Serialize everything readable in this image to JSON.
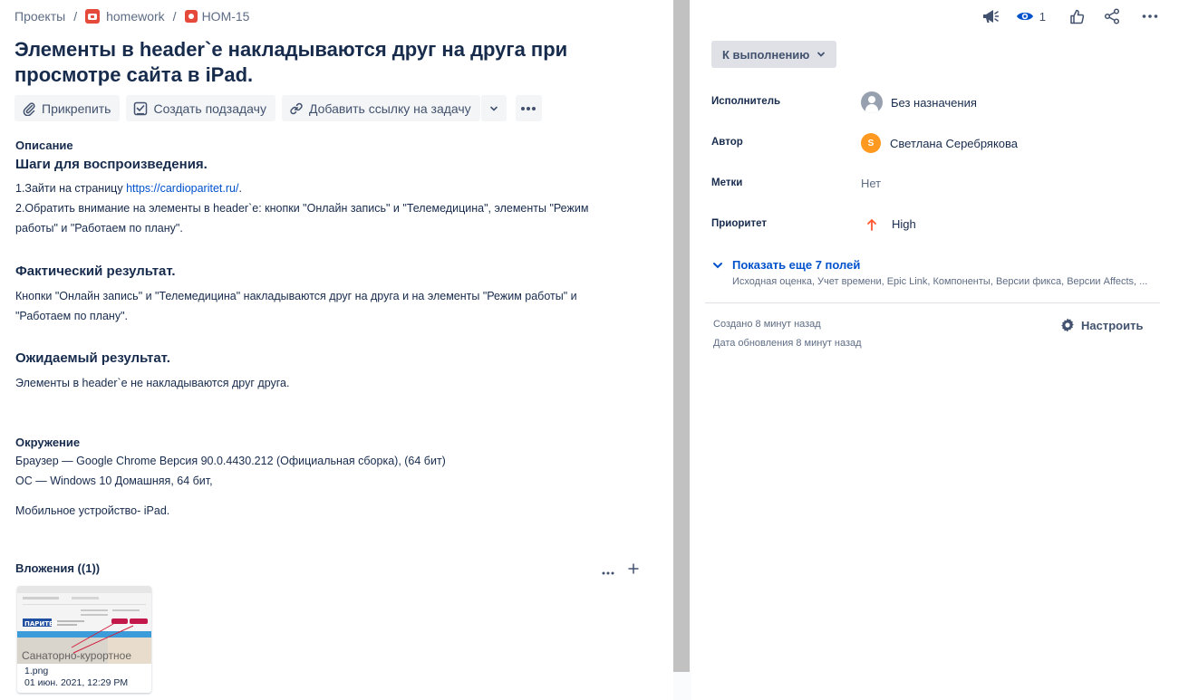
{
  "breadcrumb": {
    "projects": "Проекты",
    "project": "homework",
    "issue_key": "HOM-15"
  },
  "issue": {
    "title": "Элементы в header`е накладываются друг на друга при просмотре сайта в iPad."
  },
  "toolbar": {
    "attach": "Прикрепить",
    "subtask": "Создать подзадачу",
    "link": "Добавить ссылку на задачу"
  },
  "description": {
    "label": "Описание",
    "steps_heading": "Шаги для воспроизведения.",
    "step1_prefix": "1.Зайти на страницу ",
    "step1_link": "https://cardioparitet.ru/",
    "step1_suffix": ".",
    "step2": "2.Обратить внимание на элементы в header`е: кнопки \"Онлайн запись\" и \"Телемедицина\", элементы \"Режим работы\" и \"Работаем по плану\".",
    "actual_heading": "Фактический результат.",
    "actual_text": "Кнопки \"Онлайн запись\" и \"Телемедицина\" накладываются друг на друга и на  элементы \"Режим работы\" и \"Работаем по плану\".",
    "expected_heading": "Ожидаемый результат.",
    "expected_text": "Элементы в header`е не накладываются друг друга."
  },
  "environment": {
    "label": "Окружение",
    "browser": "Браузер —  Google Chrome Версия 90.0.4430.212 (Официальная сборка), (64 бит)",
    "os": "ОС — Windows 10 Домашняя, 64 бит,",
    "device": "Мобильное устройство- iPad."
  },
  "attachments": {
    "label": "Вложения ((1))",
    "items": [
      {
        "filename": "1.png",
        "date": "01 июн. 2021, 12:29 PM",
        "preview_text": "Санаторно-курортное",
        "preview_logo": "ПАРИТЕТ"
      }
    ]
  },
  "sidebar": {
    "watch_count": "1",
    "status": "К выполнению",
    "fields": {
      "assignee_label": "Исполнитель",
      "assignee_value": "Без назначения",
      "reporter_label": "Автор",
      "reporter_value": "Светлана Серебрякова",
      "reporter_initial": "S",
      "labels_label": "Метки",
      "labels_value": "Нет",
      "priority_label": "Приоритет",
      "priority_value": "High"
    },
    "more_fields_link": "Показать еще 7 полей",
    "more_fields_list": "Исходная оценка, Учет времени, Epic Link, Компоненты, Версии фикса, Версии Affects, ...",
    "created": "Создано 8 минут назад",
    "updated": "Дата обновления 8 минут назад",
    "configure": "Настроить"
  },
  "colors": {
    "link": "#0052cc",
    "priority_high": "#ff5630",
    "project_icon": "#e5493a",
    "avatar_reporter": "#ff991f"
  }
}
